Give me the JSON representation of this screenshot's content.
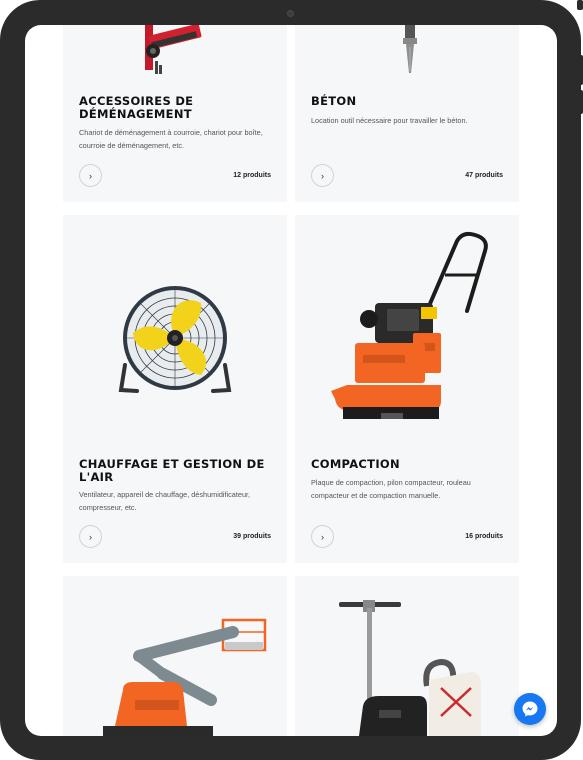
{
  "categories": [
    {
      "title": "ACCESSOIRES DE DÉMÉNAGEMENT",
      "description": "Chariot de déménagement à courroie, chariot pour boîte, courroie de déménagement, etc.",
      "count": "12 produits",
      "icon": "moving-dolly"
    },
    {
      "title": "BÉTON",
      "description": "Location outil nécessaire pour travailler le béton.",
      "count": "47 produits",
      "icon": "concrete-breaker"
    },
    {
      "title": "CHAUFFAGE ET GESTION DE L'AIR",
      "description": "Ventilateur, appareil de chauffage, déshumidificateur, compresseur, etc.",
      "count": "39 produits",
      "icon": "floor-fan"
    },
    {
      "title": "COMPACTION",
      "description": "Plaque de compaction, pilon compacteur, rouleau compacteur et de compaction manuelle.",
      "count": "16 produits",
      "icon": "plate-compactor"
    },
    {
      "icon": "boom-lift"
    },
    {
      "icon": "floor-sander"
    }
  ],
  "arrow_glyph": "›",
  "colors": {
    "card_bg": "#f6f7f9",
    "accent_orange": "#f26522",
    "messenger_blue": "#1877f2",
    "device_frame": "#2b2b2b"
  }
}
